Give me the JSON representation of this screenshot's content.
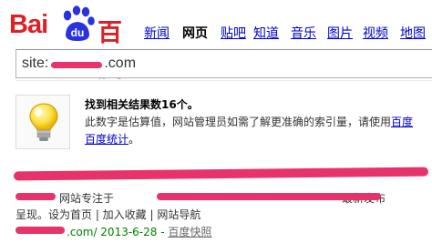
{
  "brand": {
    "latin": "Bai",
    "paw_text": "du",
    "chinese": "百度",
    "red": "#de1f26",
    "blue": "#2932e1"
  },
  "nav": {
    "items": [
      {
        "label": "新闻",
        "current": false
      },
      {
        "label": "网页",
        "current": true
      },
      {
        "label": "贴吧",
        "current": false
      },
      {
        "label": "知道",
        "current": false
      },
      {
        "label": "音乐",
        "current": false
      },
      {
        "label": "图片",
        "current": false
      },
      {
        "label": "视频",
        "current": false
      },
      {
        "label": "地图",
        "current": false
      }
    ]
  },
  "search": {
    "value": "site:",
    "value_tail": ".com"
  },
  "tip": {
    "icon": "lightbulb-icon",
    "title": "找到相关结果数16个。",
    "body_text": "此数字是估算值，网站管理员如需了解更准确的索引量，请使用",
    "body_link": "百度",
    "line2_link": "百度统计",
    "line2_end": "。"
  },
  "result": {
    "title_visible": "...",
    "desc_prefix": "网站专注于",
    "desc_suffix": "最新发布",
    "desc_line2": "呈现。设为首页 | 加入收藏 | 网站导航",
    "url_tail": ".com/ 2013-6-28",
    "sep": " - ",
    "cache_label": "百度快照"
  },
  "colors": {
    "link": "#0000cc",
    "url_green": "#008000",
    "redaction": "#e8326a"
  }
}
